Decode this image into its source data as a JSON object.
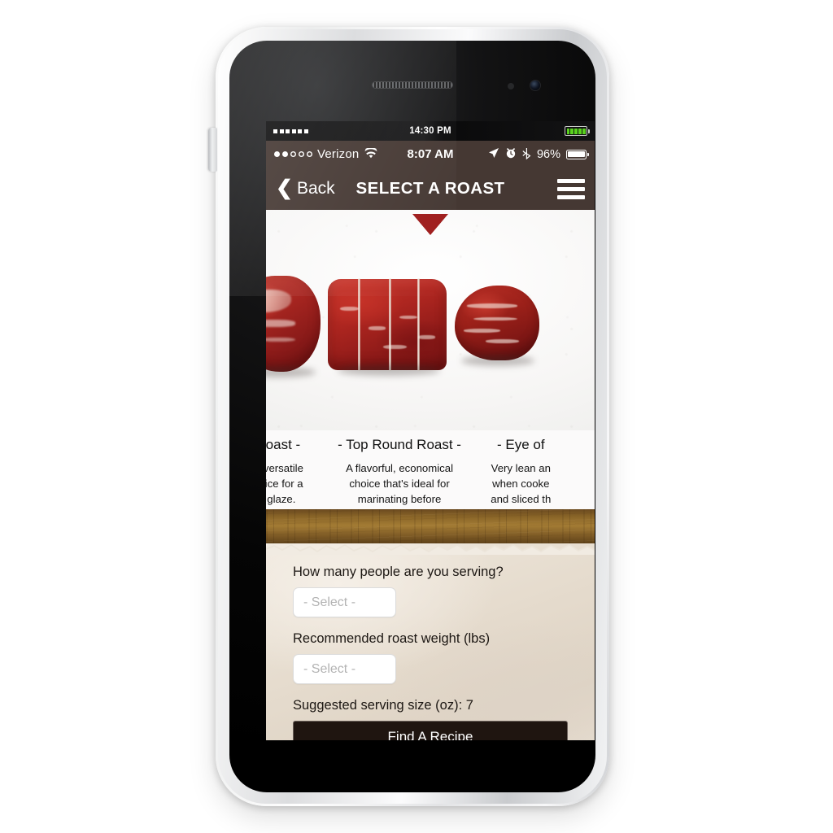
{
  "device": {
    "name": "white-smartphone",
    "icons": {
      "earpiece": "speaker-grille-icon",
      "camera": "front-camera-icon",
      "sensor": "proximity-sensor-icon",
      "side_button": "volume-button-icon"
    }
  },
  "android_status_bar": {
    "clock": "14:30 PM",
    "signal_bars": 6,
    "battery_segments": 5,
    "battery_color": "#59d21e",
    "signal_icon": "signal-bars-icon",
    "battery_icon": "battery-icon"
  },
  "ios_status_bar": {
    "carrier": "Verizon",
    "signal_dots_filled": 2,
    "signal_dots_total": 5,
    "wifi_icon": "wifi-icon",
    "clock": "8:07 AM",
    "location_icon": "location-arrow-icon",
    "alarm_icon": "alarm-clock-icon",
    "bluetooth_icon": "bluetooth-icon",
    "battery_percent": "96%",
    "battery_icon": "battery-icon",
    "background_color": "#453833"
  },
  "nav_bar": {
    "back_label": "Back",
    "back_icon": "chevron-left-icon",
    "title": "SELECT A ROAST",
    "menu_icon": "hamburger-menu-icon",
    "background_color": "#453833"
  },
  "carousel": {
    "selected_index": 1,
    "indicator_icon": "triangle-down-icon",
    "indicator_color": "#9e1b1b",
    "cards": [
      {
        "title": "Roast -",
        "full_title": "- Chuck Roast -",
        "description": "is versatile\nhoice for a\nr glaze.",
        "photo": "beef-roast-photo",
        "clipped": "left"
      },
      {
        "title": "- Top Round Roast -",
        "full_title": "- Top Round Roast -",
        "description": "A flavorful, economical choice that's ideal for marinating before roasting.",
        "photo": "beef-roast-photo",
        "clipped": "none"
      },
      {
        "title": "- Eye of ",
        "full_title": "- Eye of Round Roast -",
        "description": "Very lean an\nwhen cooke\nand sliced th",
        "photo": "beef-roast-photo",
        "clipped": "right"
      }
    ]
  },
  "form": {
    "serving_label": "How many people are you serving?",
    "serving_select_value": "- Select -",
    "weight_label": "Recommended roast weight (lbs)",
    "weight_select_value": "- Select -",
    "suggested_serving_size": "Suggested serving size (oz): 7",
    "submit_label": "Find A Recipe",
    "submit_background": "#1f1510"
  }
}
